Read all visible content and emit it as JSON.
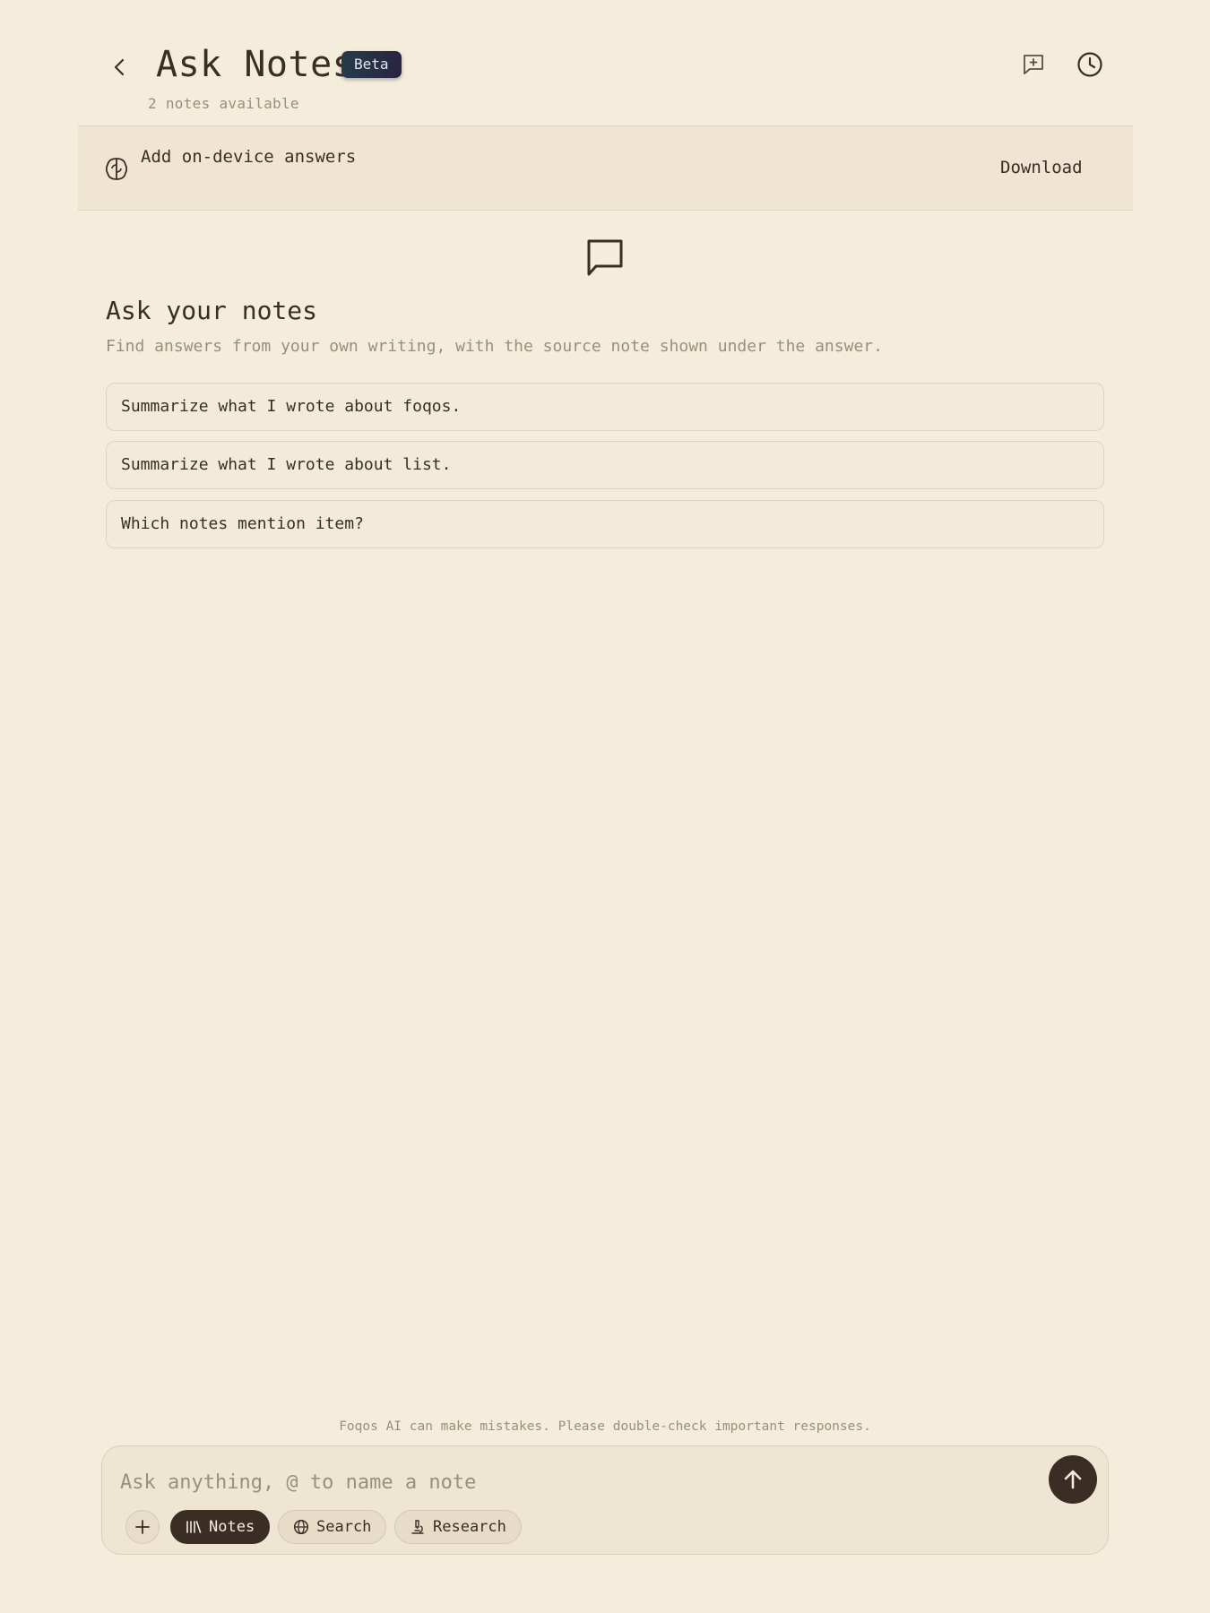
{
  "header": {
    "title": "Ask Notes",
    "badge": "Beta",
    "subtitle": "2 notes available"
  },
  "banner": {
    "text": "Add on-device answers",
    "action": "Download"
  },
  "empty_state": {
    "heading": "Ask your notes",
    "description": "Find answers from your own writing, with the source note shown under the answer."
  },
  "suggestions": [
    "Summarize what I wrote about foqos.",
    "Summarize what I wrote about list.",
    "Which notes mention item?"
  ],
  "disclaimer": "Foqos AI can make mistakes. Please double-check important responses.",
  "composer": {
    "placeholder": "Ask anything, @ to name a note",
    "chips": [
      {
        "label": "Notes",
        "icon": "library-icon",
        "active": true
      },
      {
        "label": "Search",
        "icon": "globe-icon",
        "active": false
      },
      {
        "label": "Research",
        "icon": "microscope-icon",
        "active": false
      }
    ]
  },
  "colors": {
    "background": "#f5eddb",
    "text": "#3a2e24",
    "muted": "#9a8e7c",
    "banner": "#efe5d2",
    "accent_dark": "#3a2e24"
  }
}
